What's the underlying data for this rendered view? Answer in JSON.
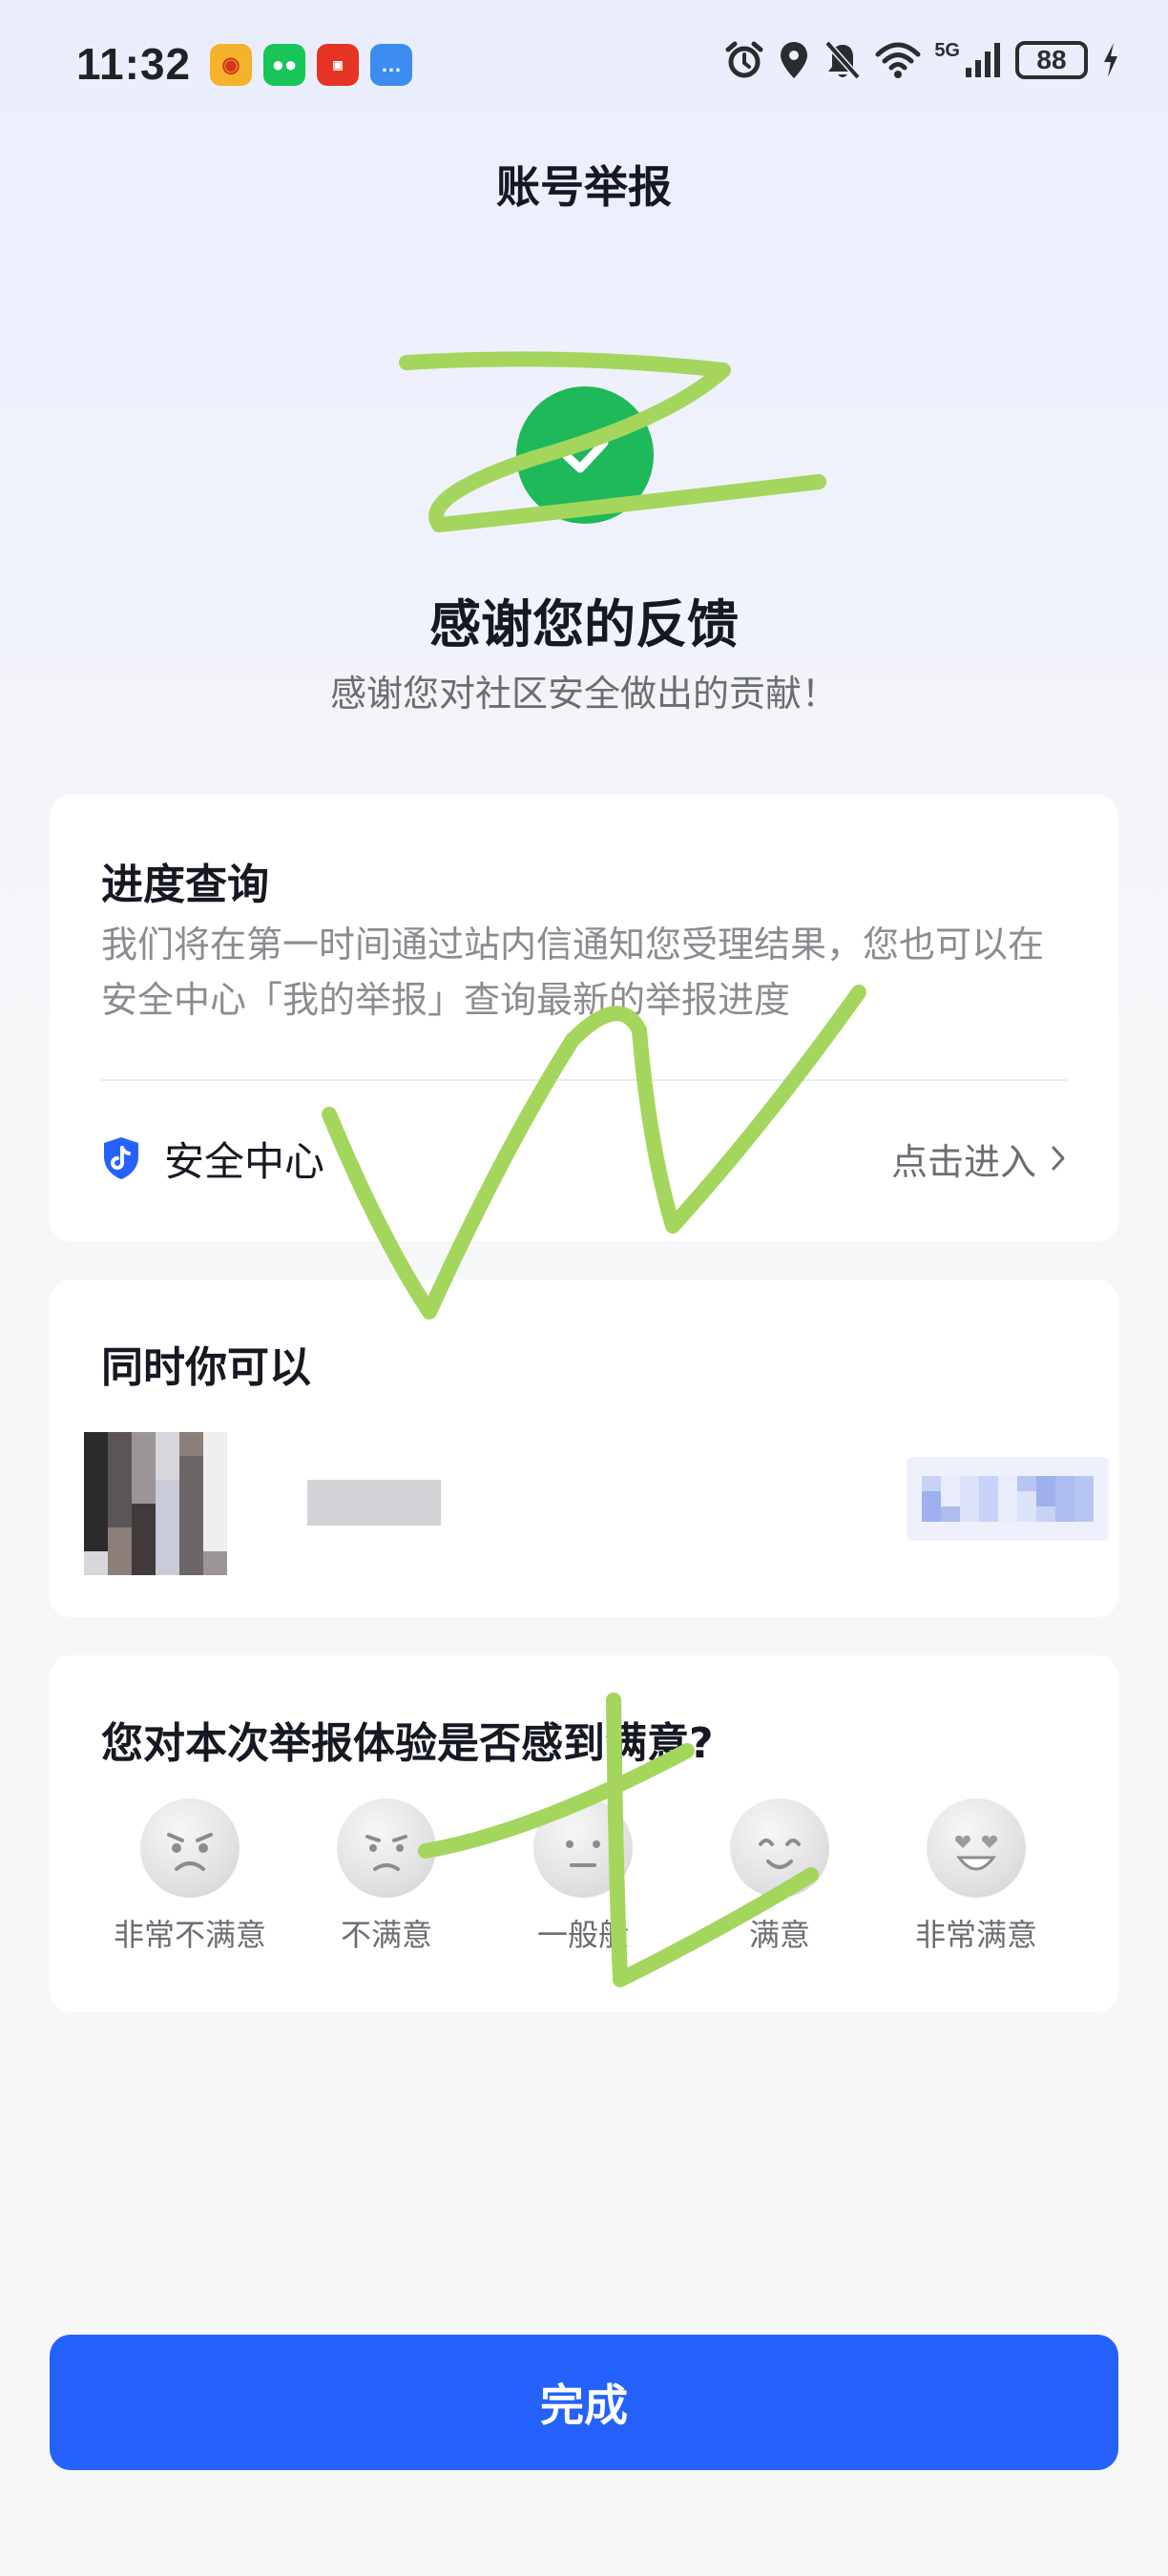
{
  "status_bar": {
    "time": "11:32",
    "battery": "88",
    "network": "5G",
    "notification_icons": [
      "weibo-icon",
      "wechat-icon",
      "shopping-app-icon",
      "message-icon"
    ],
    "system_icons": [
      "alarm-icon",
      "location-icon",
      "mute-icon",
      "wifi-icon",
      "signal-icon",
      "battery-icon",
      "charging-icon"
    ]
  },
  "header": {
    "title": "账号举报"
  },
  "result": {
    "title": "感谢您的反馈",
    "subtitle": "感谢您对社区安全做出的贡献！"
  },
  "progress": {
    "title": "进度查询",
    "description": "我们将在第一时间通过站内信通知您受理结果，您也可以在安全中心「我的举报」查询最新的举报进度",
    "security_label": "安全中心",
    "enter_label": "点击进入"
  },
  "also": {
    "title": "同时你可以"
  },
  "rating": {
    "title": "您对本次举报体验是否感到满意?",
    "options": [
      {
        "label": "非常不满意"
      },
      {
        "label": "不满意"
      },
      {
        "label": "一般般"
      },
      {
        "label": "满意"
      },
      {
        "label": "非常满意"
      }
    ]
  },
  "footer": {
    "done_label": "完成"
  },
  "colors": {
    "accent": "#2462fb",
    "success": "#1fb85a",
    "scribble": "#a4d65e"
  }
}
